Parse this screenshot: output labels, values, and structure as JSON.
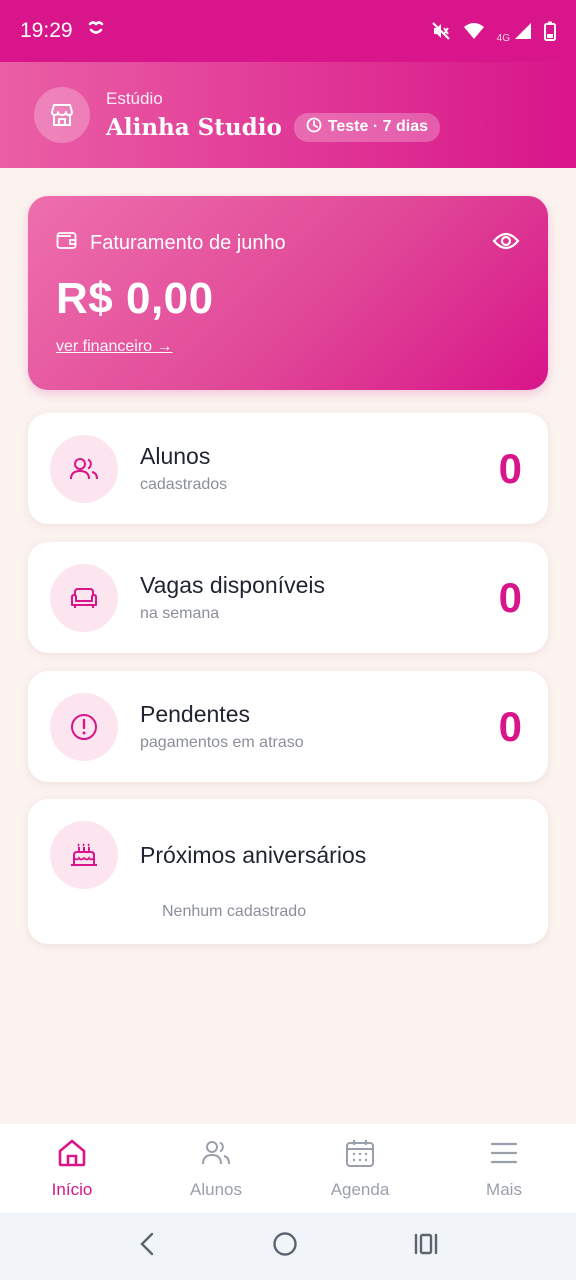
{
  "status_bar": {
    "time": "19:29",
    "network": "4G"
  },
  "header": {
    "subtitle": "Estúdio",
    "title": "Alinha Studio",
    "badge": "Teste · 7 dias"
  },
  "revenue": {
    "label": "Faturamento de junho",
    "value": "R$ 0,00",
    "link": "ver financeiro →"
  },
  "stats": [
    {
      "title": "Alunos",
      "subtitle": "cadastrados",
      "count": "0"
    },
    {
      "title": "Vagas disponíveis",
      "subtitle": "na semana",
      "count": "0"
    },
    {
      "title": "Pendentes",
      "subtitle": "pagamentos em atraso",
      "count": "0"
    }
  ],
  "birthdays": {
    "title": "Próximos aniversários",
    "empty": "Nenhum cadastrado"
  },
  "nav": [
    {
      "label": "Início",
      "icon": "home-icon",
      "active": true
    },
    {
      "label": "Alunos",
      "icon": "users-icon",
      "active": false
    },
    {
      "label": "Agenda",
      "icon": "calendar-icon",
      "active": false
    },
    {
      "label": "Mais",
      "icon": "menu-icon",
      "active": false
    }
  ],
  "colors": {
    "accent": "#d8158a",
    "background": "#fbf3ef",
    "icon_bg": "#fde5f0"
  }
}
